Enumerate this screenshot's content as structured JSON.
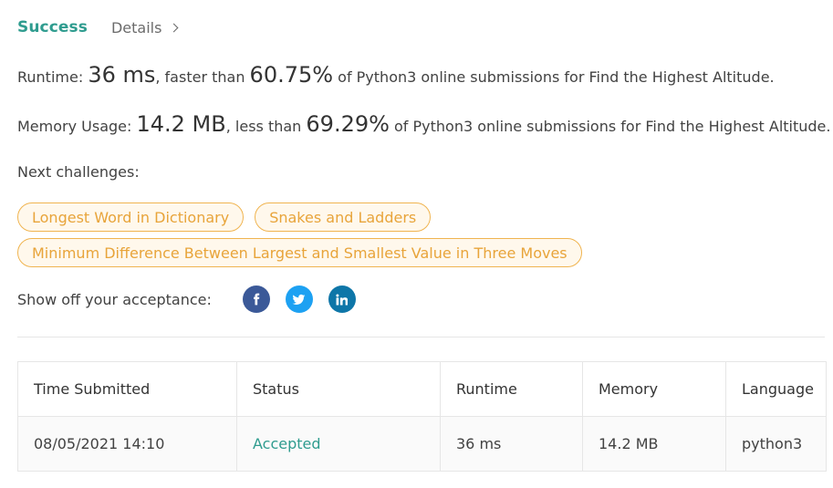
{
  "header": {
    "status": "Success",
    "details_label": "Details"
  },
  "stats": {
    "runtime": {
      "label": "Runtime: ",
      "value": "36 ms",
      "comparison": ", faster than ",
      "percent": "60.75%",
      "suffix": " of Python3 online submissions for Find the Highest Altitude."
    },
    "memory": {
      "label": "Memory Usage: ",
      "value": "14.2 MB",
      "comparison": ", less than ",
      "percent": "69.29%",
      "suffix": " of Python3 online submissions for Find the Highest Altitude."
    }
  },
  "next_challenges": {
    "label": "Next challenges:",
    "items": [
      "Longest Word in Dictionary",
      "Snakes and Ladders",
      "Minimum Difference Between Largest and Smallest Value in Three Moves"
    ]
  },
  "share": {
    "label": "Show off your acceptance:",
    "icons": [
      "facebook-icon",
      "twitter-icon",
      "linkedin-icon"
    ]
  },
  "table": {
    "headers": [
      "Time Submitted",
      "Status",
      "Runtime",
      "Memory",
      "Language"
    ],
    "rows": [
      [
        "08/05/2021 14:10",
        "Accepted",
        "36 ms",
        "14.2 MB",
        "python3"
      ]
    ]
  },
  "colors": {
    "success": "#2f9c8f",
    "tag_border": "#f0b450",
    "tag_text": "#e8a43a",
    "facebook": "#3b5998",
    "twitter": "#1da1f2",
    "linkedin": "#0e76a8"
  }
}
